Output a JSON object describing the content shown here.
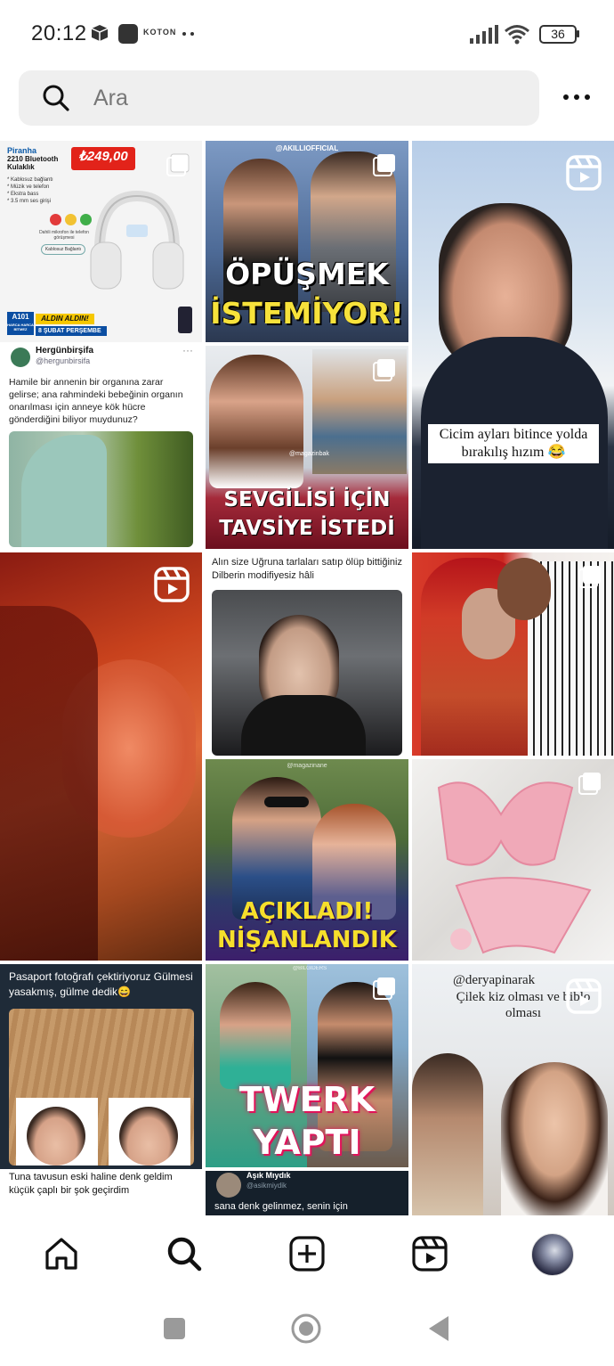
{
  "status_bar": {
    "time": "20:12",
    "carrier_badge": "KOTON",
    "battery": "36"
  },
  "search": {
    "placeholder": "Ara"
  },
  "tiles": [
    {
      "id": "t1",
      "kind": "ad",
      "brand": "Piranha",
      "product": "2210 Bluetooth Kulaklık",
      "price": "249,00",
      "price_prefix": "₺",
      "features": [
        "* Kablosuz bağlantı",
        "* Müzik ve telefon",
        "* Ekstra bass",
        "* 3.5 mm ses girişi"
      ],
      "mic_label": "Dahili mikrofon ile telefon görüşmesi",
      "wireless_label": "Kablosuz Bağlantı",
      "store": "A101",
      "store_tag": "HARCA HARCA BİTMEZ",
      "banner": "ALDIN ALDIN!",
      "date": "8 ŞUBAT PERŞEMBE",
      "multi": true
    },
    {
      "id": "t2",
      "kind": "post",
      "source": "@AKILLIOFFICIAL",
      "headline1": "ÖPÜŞMEK",
      "headline2": "İSTEMİYOR!",
      "multi": true
    },
    {
      "id": "t3",
      "kind": "reel",
      "caption": "Cicim ayları bitince yolda bırakılış hızım 😂"
    },
    {
      "id": "t4",
      "kind": "tweet",
      "account": "Hergünbirşifa",
      "handle": "@hergunbirsifa",
      "text": "Hamile bir annenin bir organına zarar gelirse; ana rahmindeki bebeğinin organın onarılması için anneye kök hücre gönderdiğini biliyor muydunuz?"
    },
    {
      "id": "t5",
      "kind": "post",
      "source": "@magazinbak",
      "headline1": "SEVGİLİSİ İÇİN",
      "headline2": "TAVSİYE İSTEDİ",
      "multi": true
    },
    {
      "id": "t6",
      "kind": "reel"
    },
    {
      "id": "t7",
      "kind": "post",
      "text": "Alın size Uğruna tarlaları satıp ölüp bittiğiniz Dilberin modifiyesiz hâli"
    },
    {
      "id": "t8",
      "kind": "post",
      "multi": true
    },
    {
      "id": "t9",
      "kind": "post",
      "source": "@magazinane",
      "headline1": "AÇIKLADI!",
      "headline2": "NİŞANLANDIK"
    },
    {
      "id": "t10",
      "kind": "post",
      "multi": true
    },
    {
      "id": "t11",
      "kind": "post",
      "text": "Pasaport fotoğrafı çektiriyoruz Gülmesi yasakmış, gülme dedik😄",
      "subtext": "Tuna tavusun eski haline denk geldim küçük çaplı bir şok geçirdim"
    },
    {
      "id": "t12",
      "kind": "post",
      "source": "@BILGIDERS",
      "headline1": "TWERK",
      "headline2": "YAPTI",
      "multi": true
    },
    {
      "id": "t13",
      "kind": "reel",
      "handle": "@deryapinarak",
      "caption": "Çilek kiz olması ve biblo olması"
    },
    {
      "id": "t14",
      "kind": "tweet",
      "account": "Aşık Mıydık",
      "handle": "@asikmiydik",
      "text": "sana denk gelinmez, senin için"
    }
  ],
  "colors": {
    "accent": "#0095f6",
    "text": "#111111",
    "search_bg": "#efefef"
  },
  "bottom_nav": {
    "items": [
      {
        "name": "home-icon"
      },
      {
        "name": "search-icon",
        "active": true
      },
      {
        "name": "create-icon"
      },
      {
        "name": "reels-icon"
      },
      {
        "name": "profile-avatar"
      }
    ]
  },
  "system_nav": [
    "recents-button",
    "home-button",
    "back-button"
  ]
}
